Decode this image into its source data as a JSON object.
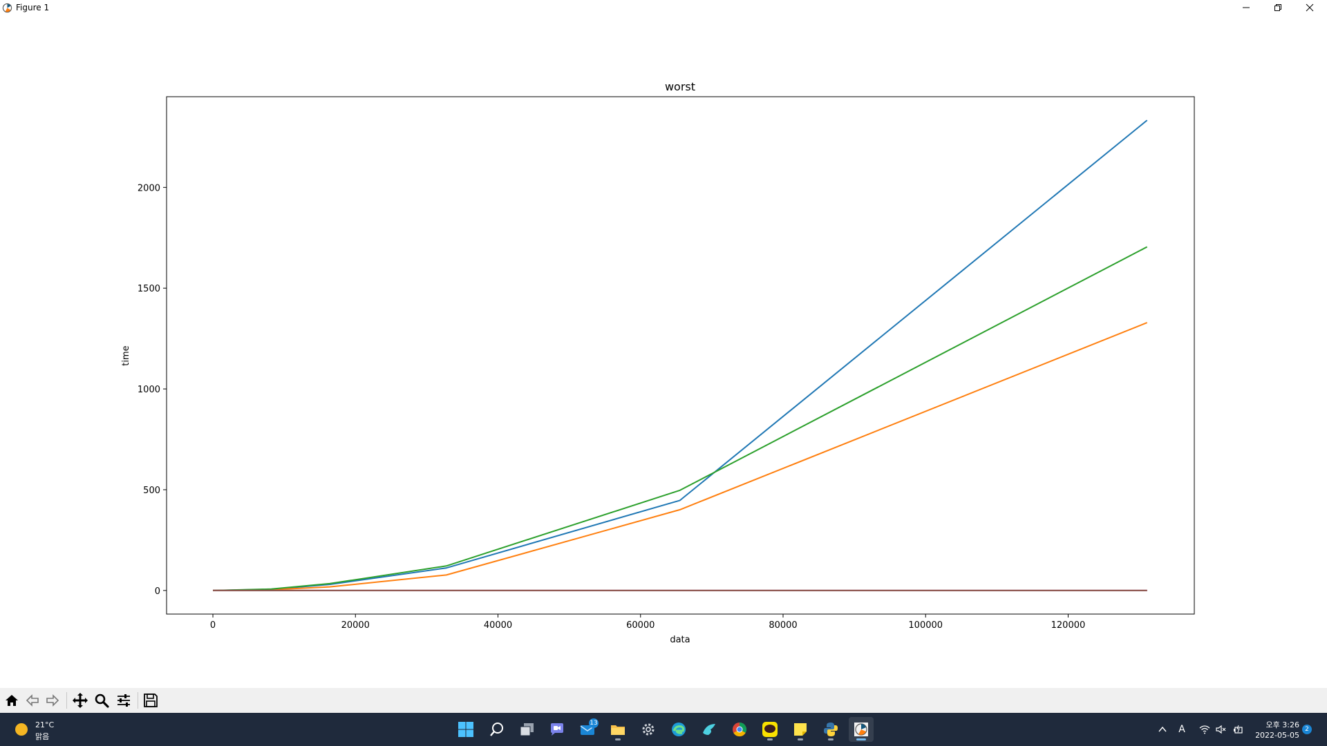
{
  "window": {
    "title": "Figure 1"
  },
  "chart_data": {
    "type": "line",
    "title": "worst",
    "xlabel": "data",
    "ylabel": "time",
    "xlim": [
      -6500,
      137700
    ],
    "ylim": [
      -117,
      2450
    ],
    "xticks": [
      0,
      20000,
      40000,
      60000,
      80000,
      100000,
      120000
    ],
    "yticks": [
      0,
      500,
      1000,
      1500,
      2000
    ],
    "x": [
      0,
      8192,
      16384,
      32768,
      65536,
      131072
    ],
    "grid": false,
    "legend": "none",
    "series": [
      {
        "color": "#1f77b4",
        "values": [
          0,
          6,
          30,
          112,
          447,
          2333
        ]
      },
      {
        "color": "#ff7f0e",
        "values": [
          0,
          4,
          18,
          77,
          401,
          1329
        ]
      },
      {
        "color": "#2ca02c",
        "values": [
          0,
          7,
          34,
          122,
          497,
          1705
        ]
      },
      {
        "color": "#d62728",
        "values": [
          0,
          0,
          0,
          0,
          0,
          0
        ]
      },
      {
        "color": "#9467bd",
        "values": [
          0,
          0,
          0,
          0,
          0,
          0
        ]
      },
      {
        "color": "#8c564b",
        "values": [
          0,
          0,
          0,
          0,
          0,
          0
        ]
      }
    ]
  },
  "toolbar": {
    "buttons": [
      {
        "name": "home-button",
        "icon": "home-icon"
      },
      {
        "name": "back-button",
        "icon": "arrow-left-icon"
      },
      {
        "name": "forward-button",
        "icon": "arrow-right-icon"
      },
      {
        "name": "pan-button",
        "icon": "move-icon"
      },
      {
        "name": "zoom-button",
        "icon": "magnifier-icon"
      },
      {
        "name": "configure-subplots-button",
        "icon": "sliders-icon"
      },
      {
        "name": "save-button",
        "icon": "floppy-icon"
      }
    ]
  },
  "taskbar": {
    "weather": {
      "temp": "21°C",
      "condition": "맑음"
    },
    "mail_badge": "13",
    "clock": {
      "time": "오후 3:26",
      "date": "2022-05-05"
    },
    "notification_count": "2",
    "ime_label": "A"
  }
}
